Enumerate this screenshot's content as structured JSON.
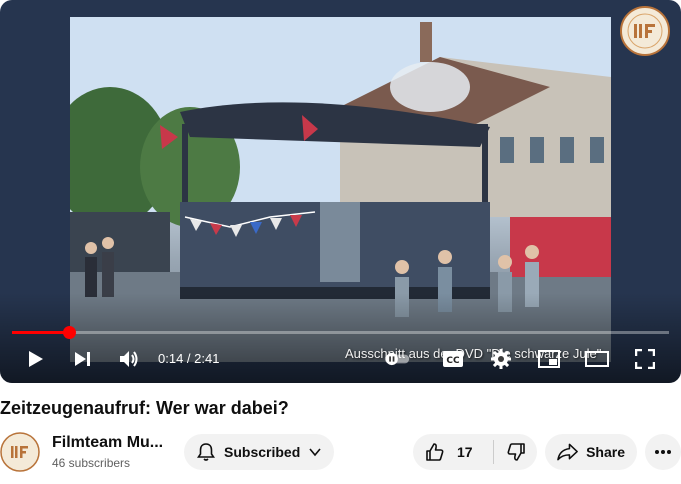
{
  "player": {
    "current_time": "0:14",
    "duration": "2:41",
    "time_separator": " / ",
    "progress_fraction": 0.087,
    "caption": "Ausschnitt aus der DVD \"Die schwarze Jule\""
  },
  "video": {
    "title": "Zeitzeugenaufruf: Wer war dabei?"
  },
  "channel": {
    "name": "Filmteam Mu...",
    "subscribers": "46 subscribers",
    "logo_text": "MF"
  },
  "actions": {
    "subscribe_label": "Subscribed",
    "like_count": "17",
    "share_label": "Share"
  },
  "colors": {
    "progress": "#ff0000",
    "pill_background": "#f2f2f2"
  },
  "icons": {
    "play": "play-icon",
    "next": "next-icon",
    "volume": "volume-icon",
    "captions": "cc-icon",
    "settings": "gear-icon",
    "miniplayer": "miniplayer-icon",
    "theater": "theater-icon",
    "fullscreen": "fullscreen-icon",
    "bell": "bell-icon",
    "like": "thumbs-up-icon",
    "dislike": "thumbs-down-icon",
    "share": "share-icon",
    "more": "more-icon"
  }
}
